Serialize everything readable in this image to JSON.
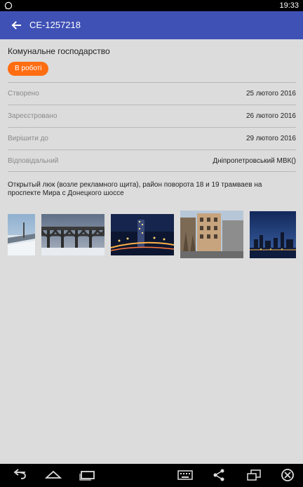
{
  "status_bar": {
    "time": "19:33",
    "notification_icon": "whatsapp-icon"
  },
  "app_bar": {
    "title": "CE-1257218",
    "back_icon": "arrow-back-icon",
    "background": "#3f51b5"
  },
  "issue": {
    "category": "Комунальне господарство",
    "status": "В роботі",
    "status_color": "#ff6d12",
    "fields": [
      {
        "label": "Створено",
        "value": "25 лютого 2016"
      },
      {
        "label": "Зареєстровано",
        "value": "26 лютого 2016"
      },
      {
        "label": "Вирішити до",
        "value": "29 лютого 2016"
      },
      {
        "label": "Відповідальний",
        "value": "Дніпропетровський МВК()"
      }
    ],
    "description": "Открытый люк (возле рекламного щита), район поворота 18 и 19 трамваев на проспекте Мира с Донецкого шоссе",
    "photos": [
      {
        "name": "photo-riverbank-winter"
      },
      {
        "name": "photo-bridge-winter"
      },
      {
        "name": "photo-city-night"
      },
      {
        "name": "photo-street-buildings"
      },
      {
        "name": "photo-city-skyline-dusk"
      }
    ]
  },
  "nav_bar": {
    "icons": [
      "back-icon",
      "home-icon",
      "recent-apps-icon",
      "keyboard-icon",
      "share-icon",
      "window-icon",
      "close-icon"
    ]
  }
}
